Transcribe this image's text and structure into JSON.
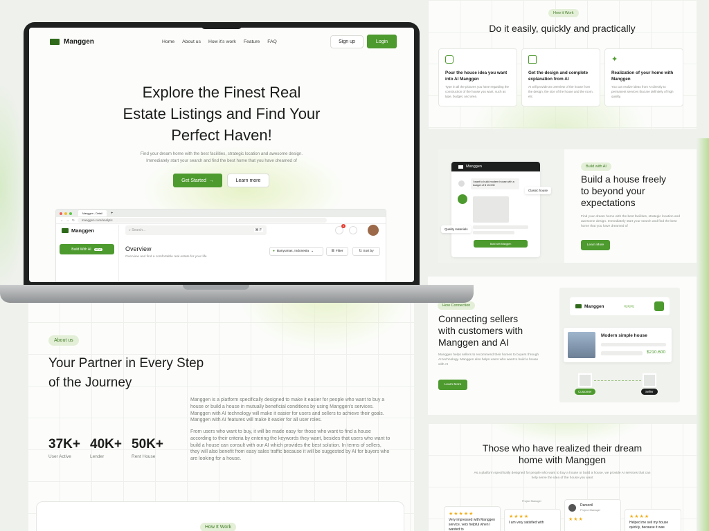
{
  "laptop": {
    "nav": {
      "brand": "Manggen",
      "links": [
        "Home",
        "About us",
        "How it's work",
        "Feature",
        "FAQ"
      ],
      "signup": "Sign up",
      "login": "Login"
    },
    "hero": {
      "title_l1": "Explore the Finest Real",
      "title_l2": "Estate Listings and Find Your",
      "title_l3": "Perfect Haven!",
      "sub_l1": "Find your dream home with the best facilities, strategic location and awesome design.",
      "sub_l2": "Immediately start your search and find the best home that you have dreamed of",
      "get_started": "Get Started",
      "learn_more": "Learn more"
    },
    "browser": {
      "tab": "Manggen - Detail",
      "url": "manggen.com/analytic"
    },
    "dash": {
      "brand": "Manggen",
      "search_placeholder": "Search...",
      "shortcut": "⌘ F",
      "build_btn": "Build With AI",
      "new_badge": "NEW",
      "overview": "Overview",
      "overview_sub": "Overview and find a comfortable real estate for your life",
      "location": "Banyumas, Indonesia",
      "filter": "Filter",
      "sort": "Sort by",
      "notif_count": "2"
    }
  },
  "about": {
    "pill": "About us",
    "title_l1": "Your Partner in Every Step",
    "title_l2": "of the Journey",
    "p1": "Manggen is a platform specifically designed to make it easier for people who want to buy a house or build a house in mutually beneficial conditions by using Manggen's services. Manggen with AI technology will make it easier for users and sellers to achieve their goals. Manggen with AI features will make it easier for all user roles.",
    "p2": "From users who want to buy, it will be made easy for those who want to find a house according to their criteria by entering the keywords they want, besides that users who want to build a house can consult with our AI which provides the best solution. In terms of sellers, they will also benefit from easy sales traffic because it will be suggested by AI for buyers who are looking for a house.",
    "stats": [
      {
        "value": "37K+",
        "label": "User Active"
      },
      {
        "value": "40K+",
        "label": "Lender"
      },
      {
        "value": "50K+",
        "label": "Rent House"
      }
    ]
  },
  "howit_bottom": {
    "pill": "How It Work"
  },
  "howit": {
    "pill": "How it Work",
    "title": "Do it easily, quickly and practically",
    "steps": [
      {
        "title": "Pour the house idea you want into AI Manggen",
        "desc": "Type in all the pictures you have regarding the construction of the house you want, such as type, budget, and area."
      },
      {
        "title": "Get the design and complete explanation from AI",
        "desc": "AI will provide an overview of the house from the design, the size of the house and the room, etc."
      },
      {
        "title": "Realization of your home with Manggen",
        "desc": "You can realize ideas from AI directly to permanent services that are definitely of high quality."
      }
    ]
  },
  "build": {
    "pill": "Build with AI",
    "title_l1": "Build a house freely",
    "title_l2": "to beyond your",
    "title_l3": "expectations",
    "desc": "Find your dream home with the best facilities, strategic location and awesome design. Immediately start your search and find the best home that you have dreamed of",
    "cta": "Learn More",
    "mock": {
      "brand": "Manggen",
      "msg": "I want to build modern house with a budget of $ 15.000",
      "tag1": "Classic house",
      "tag2": "Quality materials",
      "btn": "Build with Manggen"
    }
  },
  "connect": {
    "pill": "How Connection",
    "title_l1": "Connecting sellers",
    "title_l2": "with customers with",
    "title_l3": "Manggen and AI",
    "desc": "Manggen helps sellers to recommend their homes to buyers through AI technology. Manggen also helps users who want to build a house with AI",
    "cta": "Learn More",
    "mock": {
      "brand": "Manggen",
      "house": "Modern simple house",
      "price": "$210.600",
      "customer": "Customer",
      "seller": "Seller"
    }
  },
  "testi": {
    "title_l1": "Those who have realized their dream",
    "title_l2": "home with Manggen",
    "desc": "As a platform specifically designed for people who want to buy a house or build a house, we provide AI services that can help serve the idea of the house you want",
    "cards": [
      {
        "text": "Very impressed with Manggen service, very helpful when I wanted to",
        "role": "Project Manager"
      },
      {
        "text": "I am very satisfied with",
        "role": ""
      },
      {
        "name": "Darsonil",
        "role": "Project Manager"
      },
      {
        "text": "Helped me sell my house quickly, because it was",
        "role": ""
      }
    ]
  }
}
